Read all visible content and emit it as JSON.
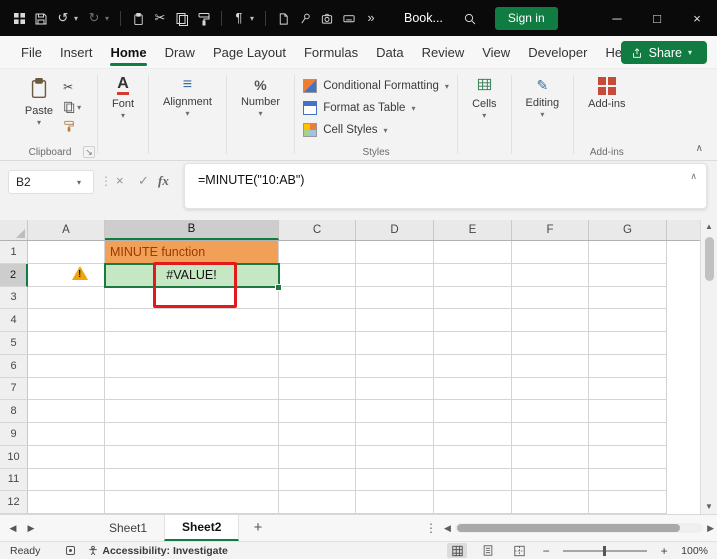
{
  "titlebar": {
    "doc_name": "Book...",
    "signin": "Sign in"
  },
  "menu": {
    "tabs": [
      "File",
      "Insert",
      "Home",
      "Draw",
      "Page Layout",
      "Formulas",
      "Data",
      "Review",
      "View",
      "Developer",
      "Help"
    ],
    "active": "Home",
    "share": "Share"
  },
  "ribbon": {
    "paste": "Paste",
    "group_clipboard": "Clipboard",
    "font": "Font",
    "alignment": "Alignment",
    "number": "Number",
    "conditional_formatting": "Conditional Formatting",
    "format_as_table": "Format as Table",
    "cell_styles": "Cell Styles",
    "group_styles": "Styles",
    "cells": "Cells",
    "editing": "Editing",
    "addins": "Add-ins",
    "group_addins": "Add-ins"
  },
  "formula_bar": {
    "name_box": "B2",
    "fx_label": "fx",
    "formula": "=MINUTE(\"10:AB\")"
  },
  "grid": {
    "columns": [
      "A",
      "B",
      "C",
      "D",
      "E",
      "F",
      "G"
    ],
    "rows": [
      "1",
      "2",
      "3",
      "4",
      "5",
      "6",
      "7",
      "8",
      "9",
      "10",
      "11",
      "12"
    ],
    "selected_cell": "B2",
    "cells": {
      "B1": "MINUTE function",
      "B2": "#VALUE!"
    }
  },
  "sheets": {
    "tabs": [
      "Sheet1",
      "Sheet2"
    ],
    "active": "Sheet2"
  },
  "status": {
    "mode": "Ready",
    "accessibility": "Accessibility: Investigate",
    "zoom": "100%"
  },
  "icons": {
    "chevron_down": "▾",
    "undo": "↺",
    "redo": "↻",
    "cut": "✂",
    "paragraph": "¶",
    "overflow": "»",
    "minimize": "─",
    "maximize": "□",
    "close": "×",
    "cancel": "×",
    "enter": "✓",
    "up": "▲",
    "down": "▼",
    "left": "◀",
    "right": "▶",
    "more": "⋮",
    "collapse": "∧",
    "dialog": "↘",
    "plus": "+",
    "alignment_glyph": "≡",
    "percent": "%",
    "font_letter": "A",
    "editing_glyph": "✎",
    "minus": "−"
  },
  "colors": {
    "accent_green": "#107C41",
    "titlebar_bg": "#0a0a0a",
    "b1_fill": "#F2A057",
    "b1_text": "#9A3B00",
    "b2_fill": "#C6E7C3",
    "annotation_red": "#E11B1B",
    "warning_orange": "#F0A30A",
    "addins_red": "#C64B38"
  }
}
